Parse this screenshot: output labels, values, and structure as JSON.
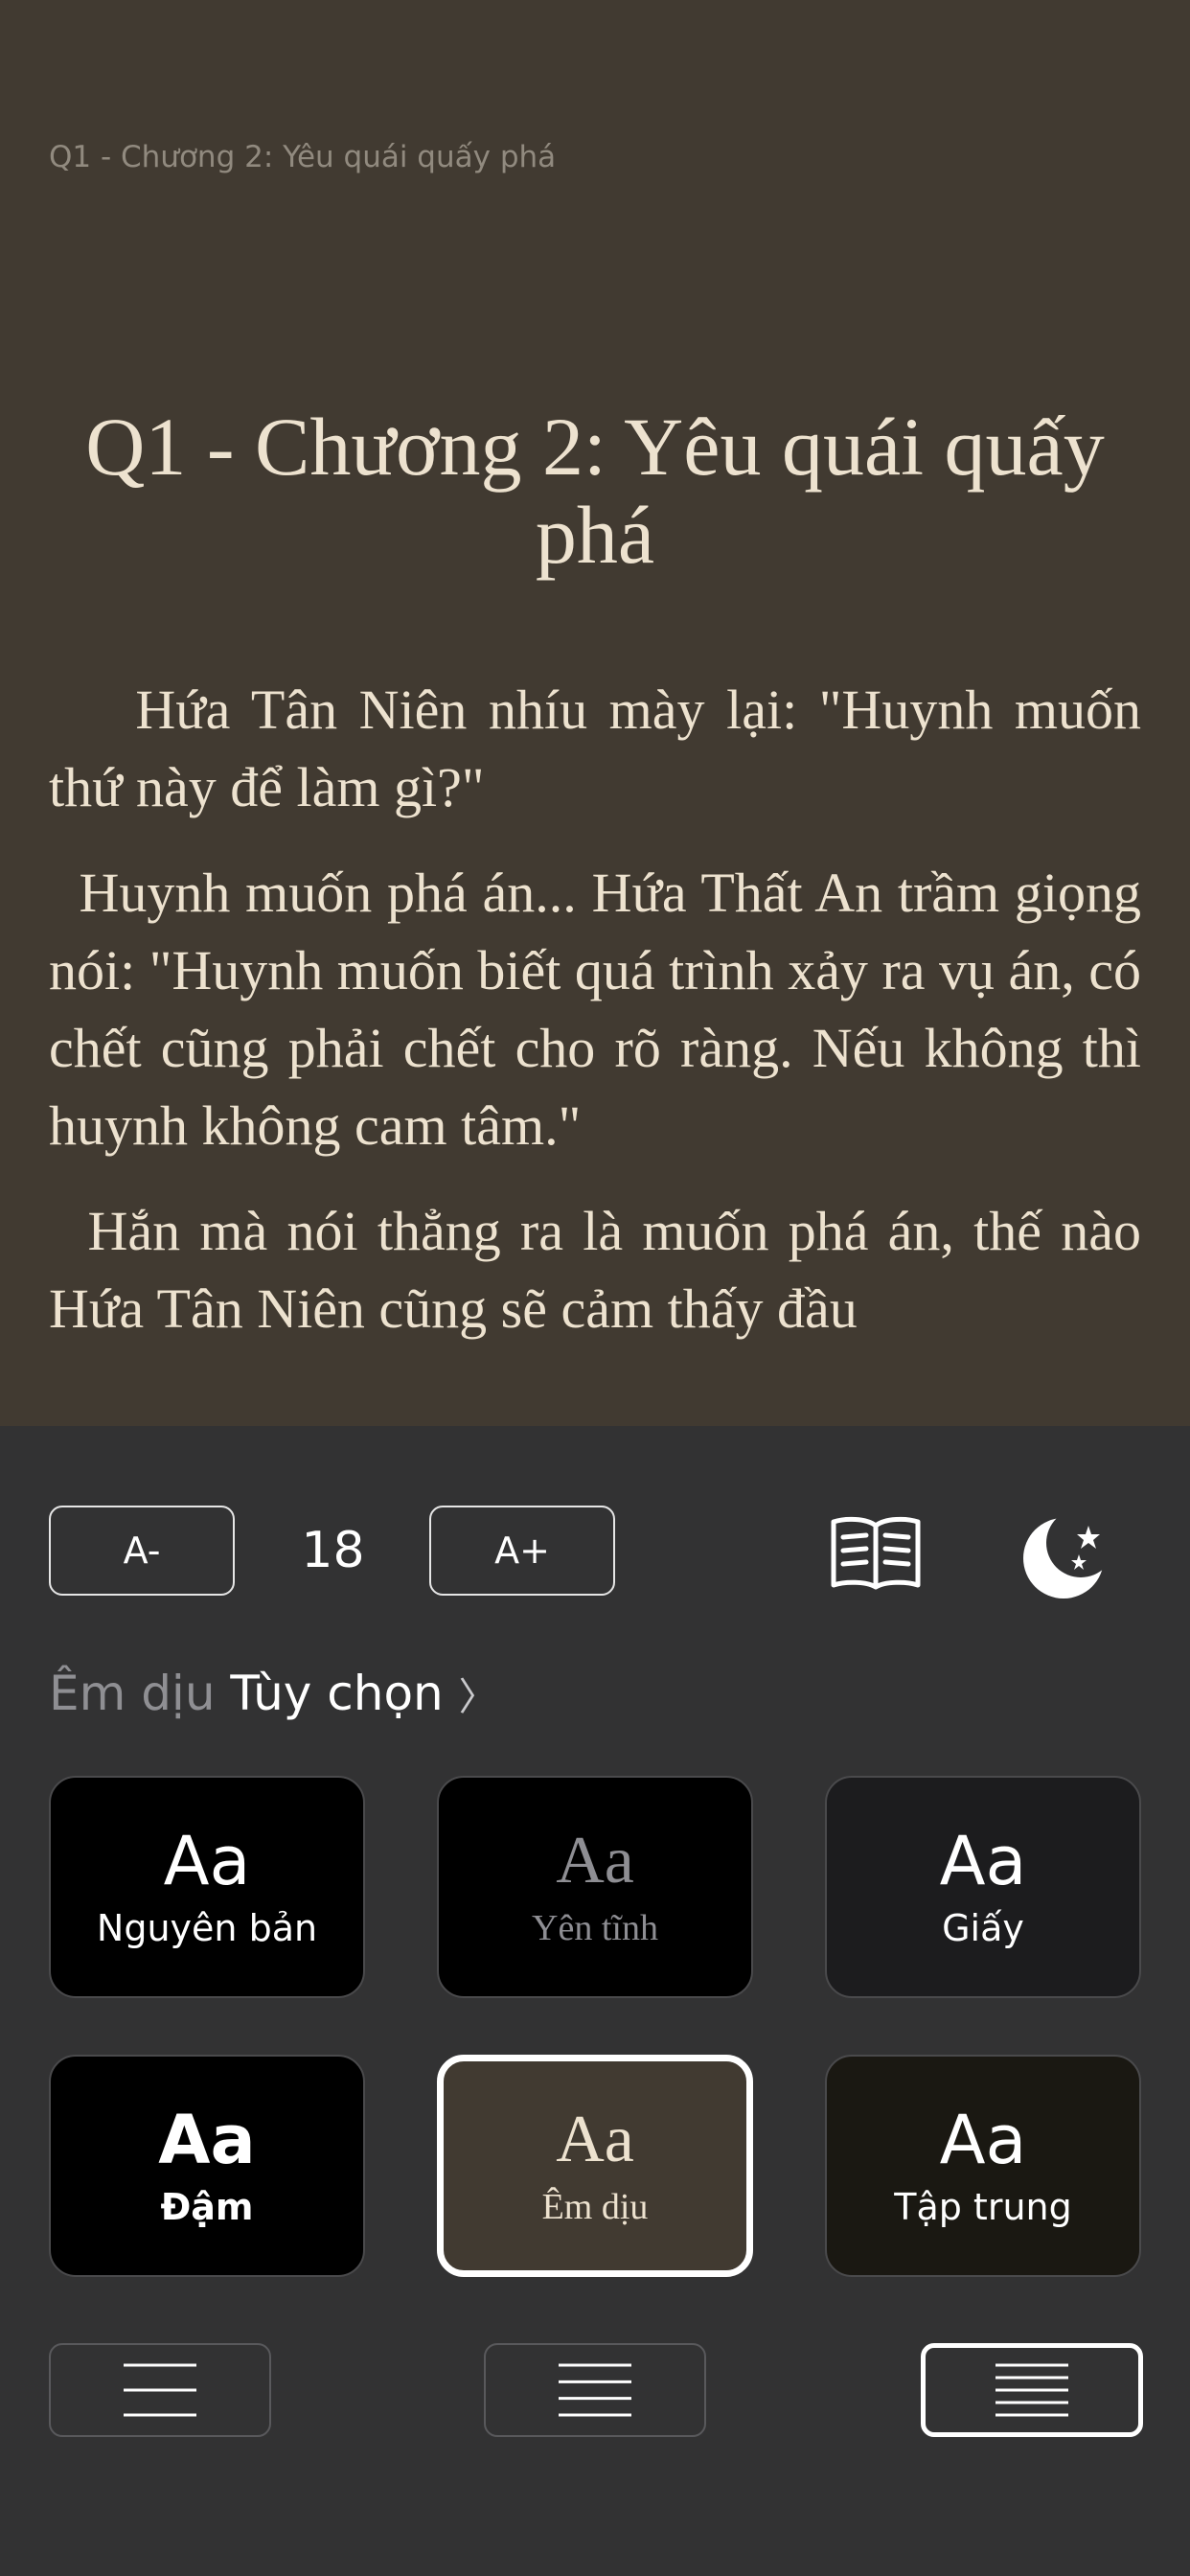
{
  "reader": {
    "running_header": "Q1 - Chương 2: Yêu quái quấy phá",
    "chapter_title": "Q1 - Chương 2: Yêu quái quấy phá",
    "paragraphs": [
      "    Hứa Tân Niên nhíu mày lại: \"Huynh muốn thứ này để làm gì?\"",
      "  Huynh muốn phá án... Hứa Thất An trầm giọng nói: \"Huynh muốn biết quá trình xảy ra vụ án, có chết cũng phải chết cho rõ ràng. Nếu không thì huynh không cam tâm.\"",
      "  Hắn mà nói thẳng ra là muốn phá án, thế nào Hứa Tân Niên cũng sẽ cảm thấy đầu"
    ]
  },
  "settings": {
    "decrease_font_label": "A-",
    "font_size": "18",
    "increase_font_label": "A+",
    "current_theme": "Êm dịu",
    "options_label": "Tùy chọn",
    "options_chevron": "〉",
    "themes": [
      {
        "aa": "Aa",
        "name": "Nguyên bản",
        "bg": "#000000",
        "fg": "#ffffff",
        "serif": false,
        "bold": false,
        "selected": false
      },
      {
        "aa": "Aa",
        "name": "Yên tĩnh",
        "bg": "#000000",
        "fg": "#8e8e93",
        "serif": true,
        "bold": false,
        "selected": false
      },
      {
        "aa": "Aa",
        "name": "Giấy",
        "bg": "#1c1c1e",
        "fg": "#ffffff",
        "serif": false,
        "bold": false,
        "selected": false
      },
      {
        "aa": "Aa",
        "name": "Đậm",
        "bg": "#000000",
        "fg": "#ffffff",
        "serif": false,
        "bold": true,
        "selected": false
      },
      {
        "aa": "Aa",
        "name": "Êm dịu",
        "bg": "#413a31",
        "fg": "#ede2cf",
        "serif": true,
        "bold": false,
        "selected": true
      },
      {
        "aa": "Aa",
        "name": "Tập trung",
        "bg": "#1a1812",
        "fg": "#ffffff",
        "serif": false,
        "bold": false,
        "selected": false
      }
    ],
    "line_spacing_options": [
      {
        "name": "line-spacing-wide",
        "lines": 3,
        "selected": false
      },
      {
        "name": "line-spacing-medium",
        "lines": 4,
        "selected": false
      },
      {
        "name": "line-spacing-compact",
        "lines": 5,
        "selected": true
      }
    ]
  },
  "colors": {
    "reader_bg": "#413a31",
    "reader_text": "#ede2cf",
    "panel_bg": "#323233",
    "accent": "#ffffff"
  },
  "icons": {
    "book": "book-icon",
    "night": "moon-stars-icon"
  }
}
